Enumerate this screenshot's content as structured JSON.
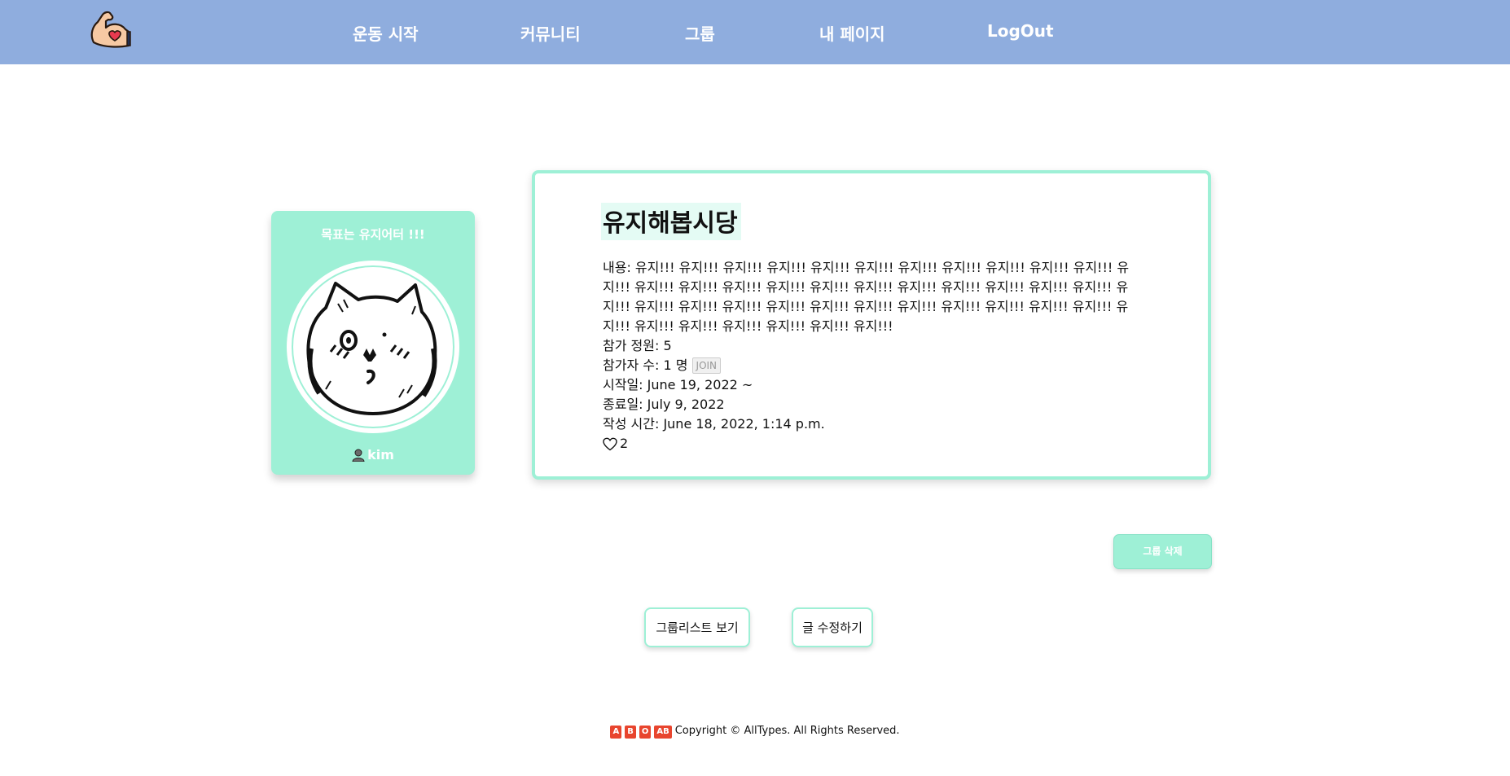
{
  "nav": {
    "items": [
      "운동 시작",
      "커뮤니티",
      "그룹",
      "내 페이지",
      "LogOut"
    ]
  },
  "profile": {
    "goal": "목표는 유지어터 !!!",
    "username": "kim"
  },
  "group": {
    "title": "유지해봅시당",
    "content": "내용: 유지!!! 유지!!! 유지!!! 유지!!! 유지!!! 유지!!! 유지!!! 유지!!! 유지!!! 유지!!! 유지!!! 유지!!! 유지!!! 유지!!! 유지!!! 유지!!! 유지!!! 유지!!! 유지!!! 유지!!! 유지!!! 유지!!! 유지!!! 유지!!! 유지!!! 유지!!! 유지!!! 유지!!! 유지!!! 유지!!! 유지!!! 유지!!! 유지!!! 유지!!! 유지!!! 유지!!! 유지!!! 유지!!! 유지!!! 유지!!! 유지!!! 유지!!!",
    "capacity": "참가 정원: 5",
    "participants": "참가자 수: 1 명",
    "join_label": "JOIN",
    "start_date": "시작일: June 19, 2022 ~",
    "end_date": "종료일: July 9, 2022",
    "created": "작성 시간: June 18, 2022, 1:14 p.m.",
    "likes": "2"
  },
  "buttons": {
    "delete": "그룹 삭제",
    "list": "그룹리스트 보기",
    "edit": "글 수정하기"
  },
  "footer": {
    "badges": [
      "A",
      "B",
      "O",
      "AB"
    ],
    "copyright": "Copyright © AllTypes. All Rights Reserved."
  },
  "colors": {
    "header": "#8fadde",
    "accent": "#9ef0d6",
    "badge": "#e8452e"
  }
}
